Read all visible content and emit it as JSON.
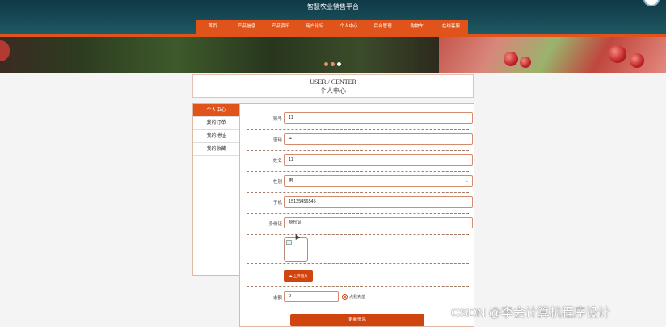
{
  "header": {
    "title": "智慧农业销售平台"
  },
  "nav": {
    "items": [
      "首页",
      "产品信息",
      "产品资讯",
      "用户论坛",
      "个人中心",
      "后台管理",
      "购物车",
      "在线客服"
    ]
  },
  "banner": {
    "slide_count": 3,
    "active_slide": 3
  },
  "page_title": {
    "en": "USER / CENTER",
    "cn": "个人中心"
  },
  "sidebar": {
    "items": [
      "个人中心",
      "我的订单",
      "我的地址",
      "我的收藏"
    ],
    "active_index": 0
  },
  "form": {
    "account": {
      "label": "账号",
      "value": "11"
    },
    "password": {
      "label": "密码",
      "value": "••"
    },
    "name": {
      "label": "姓名",
      "value": "11"
    },
    "gender": {
      "label": "性别",
      "value": "男"
    },
    "phone": {
      "label": "手机",
      "value": "15125456545"
    },
    "id_card": {
      "label": "身份证",
      "placeholder": "身份证"
    },
    "upload_label": "上传图片",
    "balance": {
      "label": "余额",
      "value": "0"
    },
    "recharge_label": "点我充值",
    "submit_label": "更新信息"
  },
  "watermark": "CSDN @李会计算机程序设计",
  "colors": {
    "accent": "#e0531b",
    "header_bg": "#0f3946"
  }
}
